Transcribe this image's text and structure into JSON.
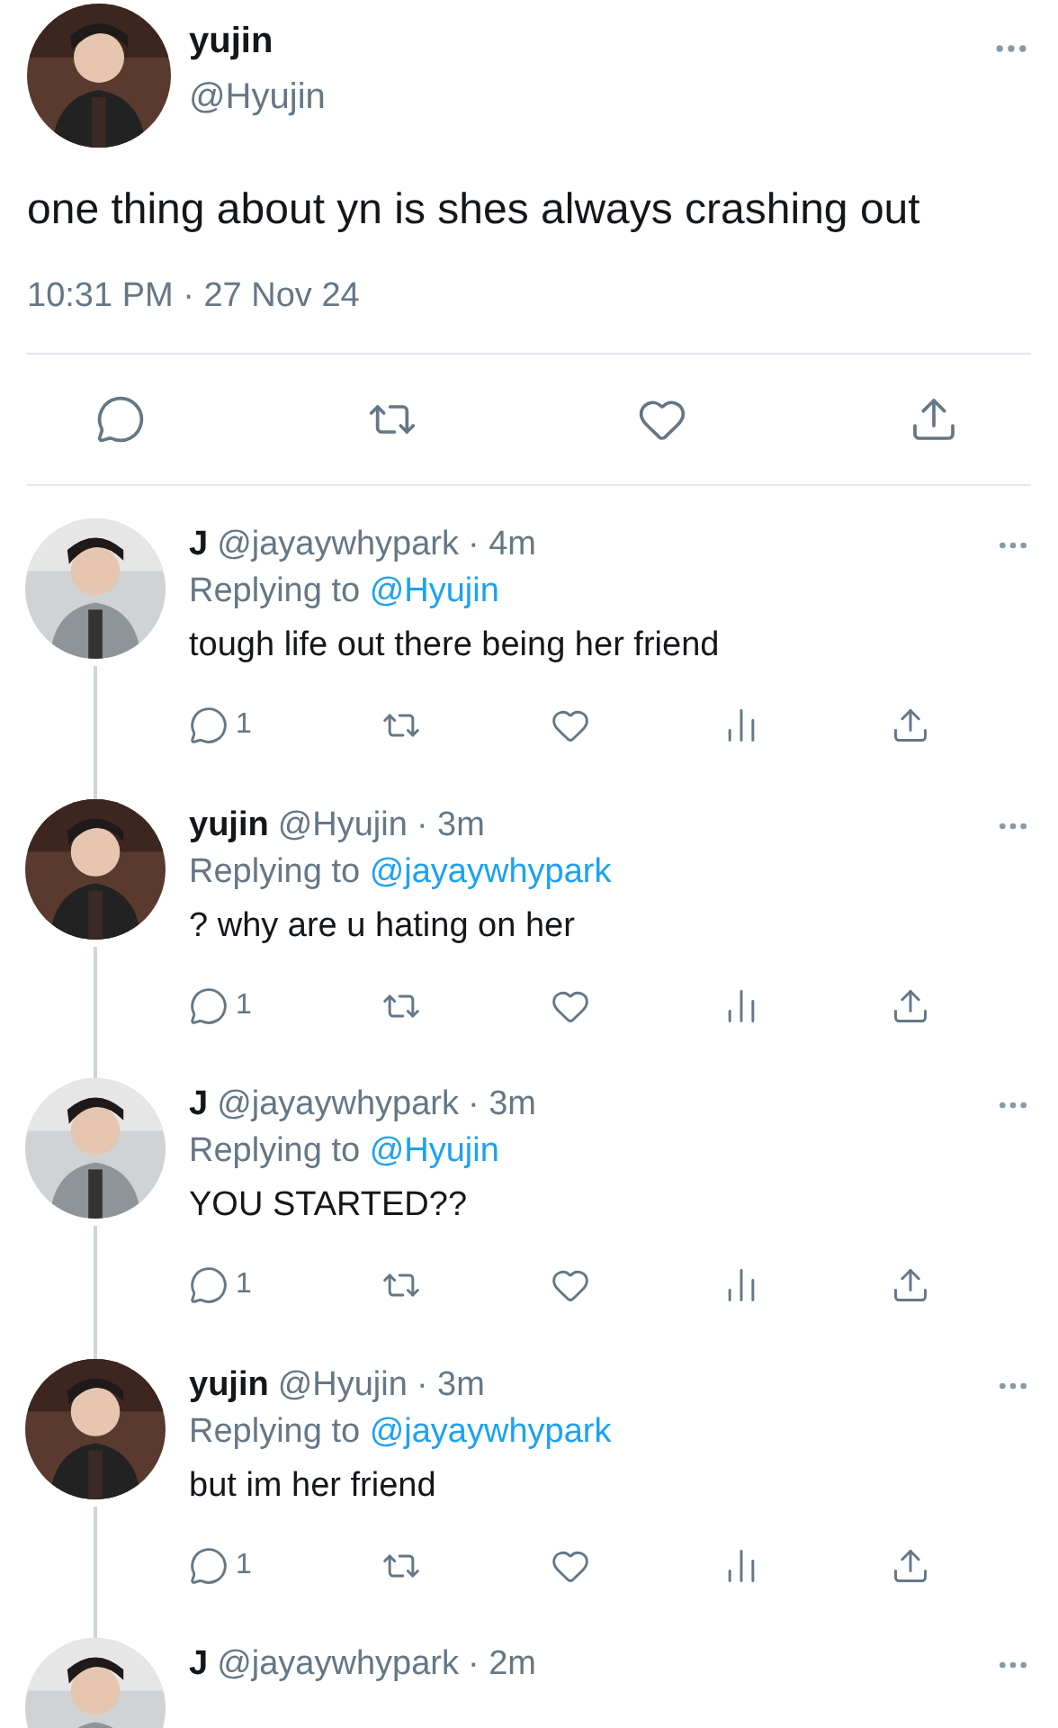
{
  "tweet": {
    "name": "yujin",
    "handle": "@Hyujin",
    "text": "one thing about yn is shes always crashing out",
    "time": "10:31 PM · 27 Nov 24"
  },
  "replies": [
    {
      "name": "J",
      "handle": "@jayaywhypark",
      "age": "· 4m",
      "replying_label": "Replying to",
      "replying_to": "@Hyujin",
      "text": "tough life out there being her friend",
      "reply_count": "1"
    },
    {
      "name": "yujin",
      "handle": "@Hyujin",
      "age": "· 3m",
      "replying_label": "Replying to",
      "replying_to": "@jayaywhypark",
      "text": "? why are u hating on her",
      "reply_count": "1"
    },
    {
      "name": "J",
      "handle": "@jayaywhypark",
      "age": "· 3m",
      "replying_label": "Replying to",
      "replying_to": "@Hyujin",
      "text": "YOU STARTED??",
      "reply_count": "1"
    },
    {
      "name": "yujin",
      "handle": "@Hyujin",
      "age": "· 3m",
      "replying_label": "Replying to",
      "replying_to": "@jayaywhypark",
      "text": "but im her friend",
      "reply_count": "1"
    },
    {
      "name": "J",
      "handle": "@jayaywhypark",
      "age": "· 2m"
    }
  ]
}
